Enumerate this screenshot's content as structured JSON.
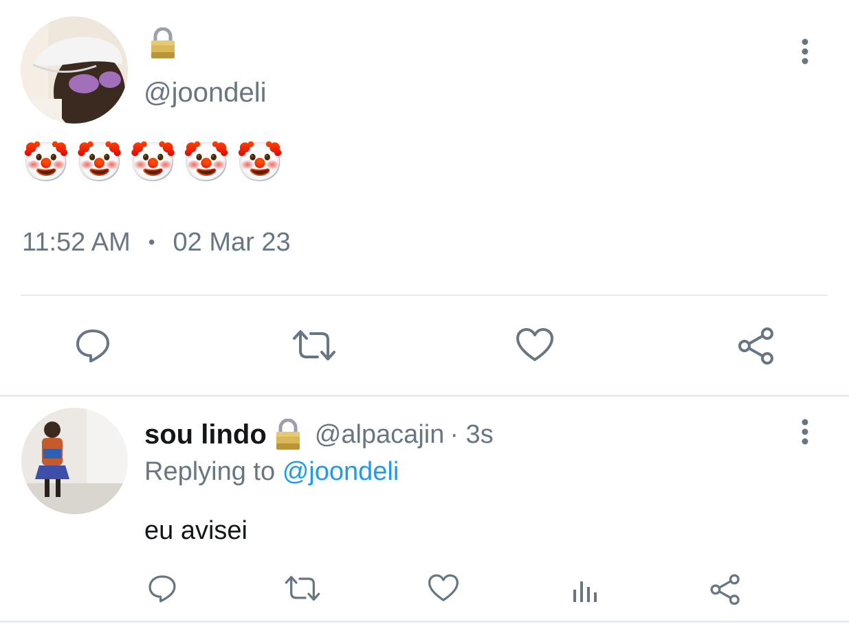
{
  "tweet": {
    "author_handle": "@joondeli",
    "lock_icon": "lock-icon",
    "body_emojis": [
      "🤡",
      "🤡",
      "🤡",
      "🤡",
      "🤡"
    ],
    "time": "11:52 AM",
    "date": "02 Mar 23",
    "separator": "•",
    "actions": [
      "reply-icon",
      "retweet-icon",
      "like-icon",
      "share-icon"
    ]
  },
  "reply": {
    "display_name": "sou lindo",
    "handle": "@alpacajin",
    "time_ago": "· 3s",
    "replying_to_label": "Replying to",
    "replying_to_handle": "@joondeli",
    "text": "eu avisei",
    "actions": [
      "reply-icon",
      "retweet-icon",
      "like-icon",
      "analytics-icon",
      "share-icon"
    ]
  },
  "colors": {
    "muted": "#687684",
    "link": "#1d9bf0",
    "divider": "#e6ecf0"
  }
}
